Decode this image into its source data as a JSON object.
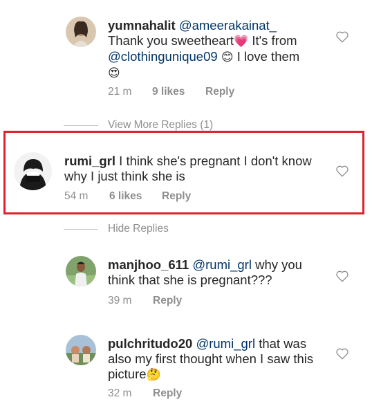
{
  "comments": [
    {
      "username": "yumnahalit",
      "mention": "@ameerakainat_",
      "text_line1": "Thank you sweetheart",
      "emoji1": "💗",
      "text_after_emoji1": " It's from",
      "mention2": "@clothingunique09",
      "emoji2": "😊",
      "text_after_emoji2": " I love them",
      "emoji3": "😍",
      "time": "21 m",
      "likes": "9 likes",
      "reply": "Reply",
      "icon": "heart-outline-icon"
    },
    {
      "username": "rumi_grl",
      "text": "I think she's pregnant I don't know why I just think she is",
      "time": "54 m",
      "likes": "6 likes",
      "reply": "Reply",
      "icon": "heart-outline-icon"
    },
    {
      "username": "manjhoo_611",
      "mention": "@rumi_grl",
      "text": "why you think that she is pregnant???",
      "time": "39 m",
      "reply": "Reply",
      "icon": "heart-outline-icon"
    },
    {
      "username": "pulchritudo20",
      "mention": "@rumi_grl",
      "text": "that was also my first thought when I saw this picture",
      "emoji": "🤔",
      "time": "32 m",
      "reply": "Reply",
      "icon": "heart-outline-icon"
    }
  ],
  "view_more_replies": "View More Replies (1)",
  "hide_replies": "Hide Replies",
  "colors": {
    "highlight_border": "#e0202a",
    "text": "#262626",
    "meta": "#8e8e8e",
    "mention": "#003569"
  }
}
